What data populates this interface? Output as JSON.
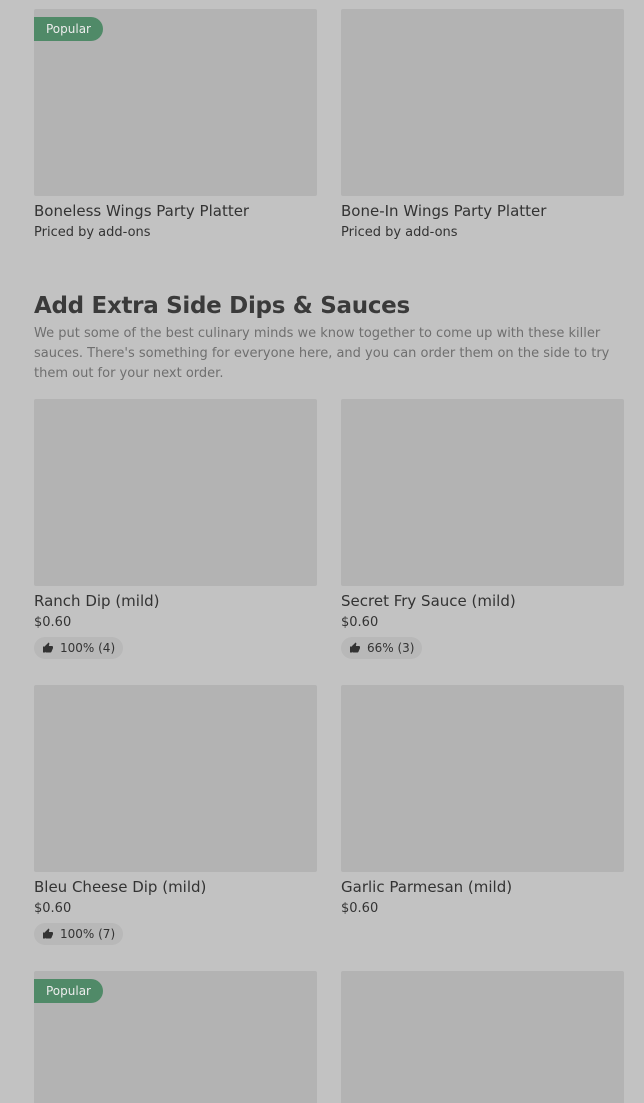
{
  "top_items": [
    {
      "name": "Boneless Wings Party Platter",
      "price": "Priced by add-ons",
      "badge": "Popular"
    },
    {
      "name": "Bone-In Wings Party Platter",
      "price": "Priced by add-ons"
    }
  ],
  "section": {
    "title": "Add Extra Side Dips & Sauces",
    "description": "We put some of the best culinary minds we know together to come up with these killer sauces. There's something for everyone here, and you can order them on the side to try them out for your next order."
  },
  "items": [
    {
      "name": "Ranch Dip (mild)",
      "price": "$0.60",
      "rating": "100% (4)"
    },
    {
      "name": "Secret Fry Sauce (mild)",
      "price": "$0.60",
      "rating": "66% (3)"
    },
    {
      "name": "Bleu Cheese Dip (mild)",
      "price": "$0.60",
      "rating": "100% (7)"
    },
    {
      "name": "Garlic Parmesan (mild)",
      "price": "$0.60"
    }
  ],
  "bottom_items": [
    {
      "badge": "Popular"
    },
    {}
  ],
  "icons": {
    "rating": "thumbs-up-icon"
  },
  "colors": {
    "background": "#c2c2c2",
    "image_placeholder": "#b3b3b3",
    "badge": "#2f7d4f"
  }
}
